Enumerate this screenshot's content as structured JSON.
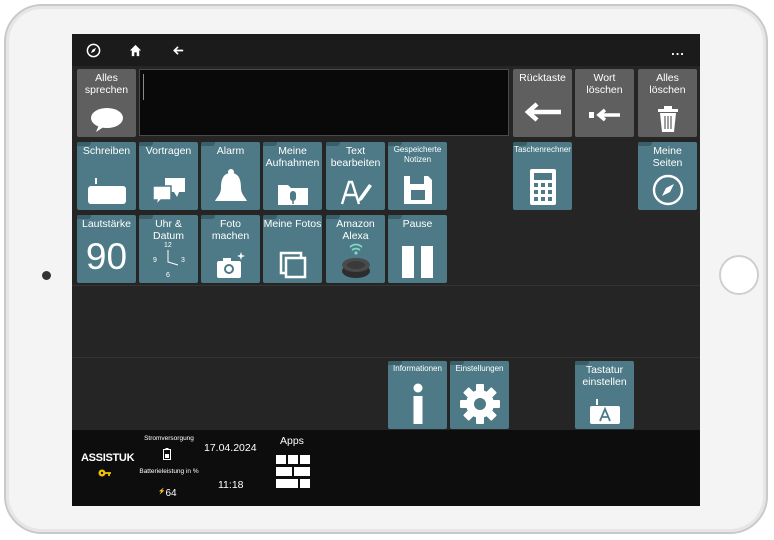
{
  "topbar": {
    "icons": [
      "compass-icon",
      "home-icon",
      "back-arrow-icon",
      "more-icon"
    ],
    "more_label": "..."
  },
  "row1": {
    "speak_all": "Alles sprechen",
    "backspace": "Rücktaste",
    "delete_word": "Wort löschen",
    "delete_all": "Alles löschen"
  },
  "row2": {
    "write": "Schreiben",
    "present": "Vortragen",
    "alarm": "Alarm",
    "my_recordings": "Meine Aufnahmen",
    "edit_text": "Text bearbeiten",
    "saved_notes": "Gespeicherte Notizen",
    "calculator": "Taschenrechner",
    "my_pages": "Meine Seiten"
  },
  "row3": {
    "volume": "Lautstärke",
    "volume_value": "90",
    "clock": "Uhr & Datum",
    "clock_12": "12",
    "clock_9": "9",
    "clock_3": "3",
    "clock_6": "6",
    "take_photo": "Foto machen",
    "my_photos": "Meine Fotos",
    "alexa": "Amazon Alexa",
    "pause": "Pause"
  },
  "row5": {
    "info": "Informationen",
    "settings": "Einstellungen",
    "keyboard_settings": "Tastatur einstellen"
  },
  "bottom": {
    "logo_text": "ASSISTUK",
    "power_label": "Stromversorgung",
    "battery_label": "Batterieleistung in %",
    "battery_value": "64",
    "date": "17.04.2024",
    "time": "11:18",
    "apps_label": "Apps"
  },
  "colors": {
    "tile": "#4d7a86",
    "tile_gray": "#5f5f5f",
    "background": "#252525"
  }
}
